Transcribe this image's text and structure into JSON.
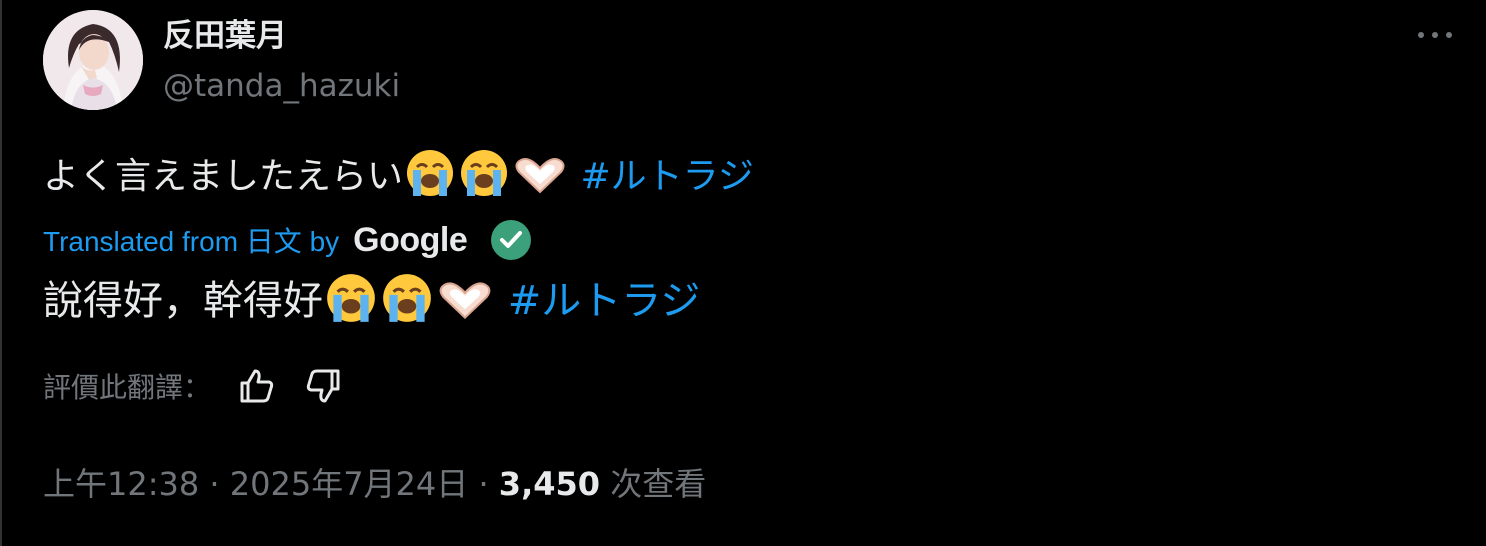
{
  "author": {
    "display_name": "反田葉月",
    "handle": "@tanda_hazuki",
    "avatar_icon": "profile-photo"
  },
  "menu_icon": "more-horizontal-icon",
  "tweet": {
    "text": "よく言えましたえらい",
    "emojis": [
      "loudly-crying-face",
      "loudly-crying-face",
      "heart-hands"
    ],
    "hashtag": "#ルトラジ"
  },
  "translation": {
    "label": "Translated from 日文 by",
    "provider": "Google",
    "verified_icon": "check-circle-icon",
    "text": "說得好，幹得好",
    "hashtag": "#ルトラジ"
  },
  "rating": {
    "label": "評價此翻譯：",
    "like_icon": "thumbs-up-icon",
    "dislike_icon": "thumbs-down-icon"
  },
  "meta": {
    "time": "上午12:38",
    "sep1": " · ",
    "date": "2025年7月24日",
    "sep2": " · ",
    "views_count": "3,450",
    "views_label": "次查看"
  },
  "colors": {
    "background": "#000000",
    "text": "#e7e9ea",
    "muted": "#71767b",
    "link": "#1d9bf0",
    "check": "#3ca07a"
  }
}
